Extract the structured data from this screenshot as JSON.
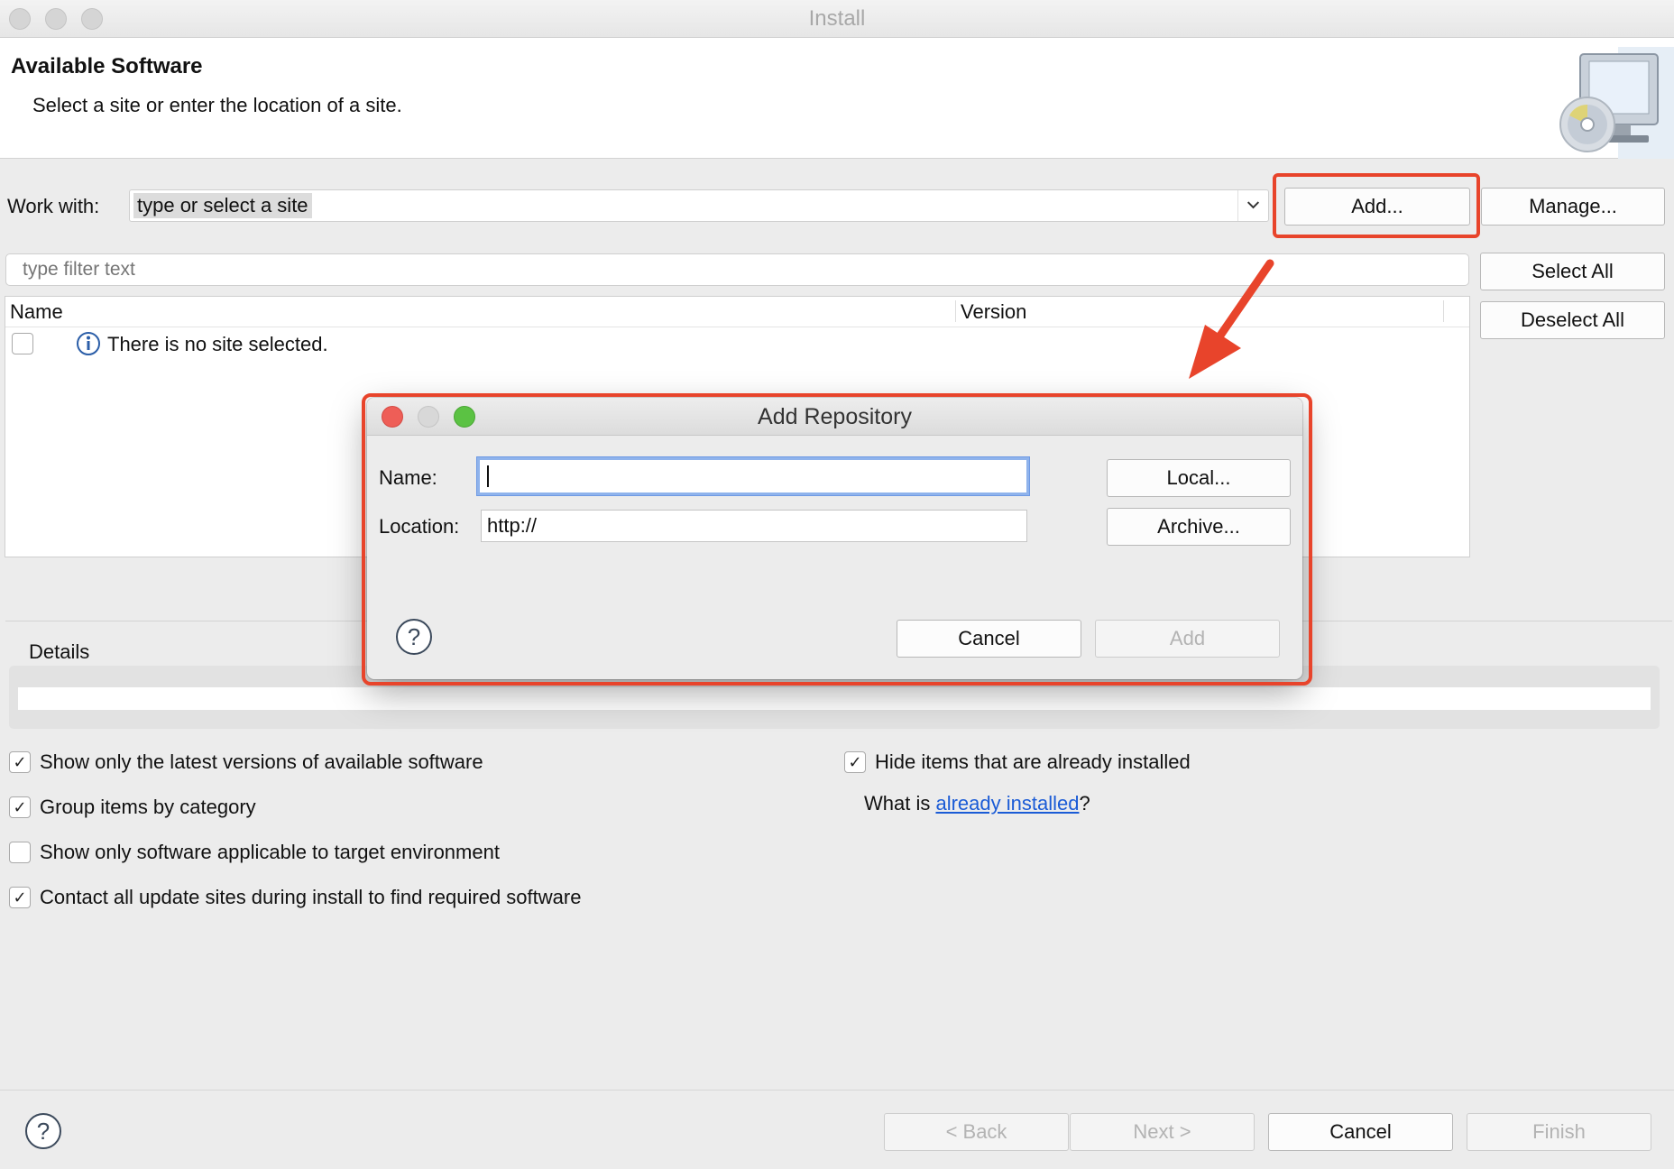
{
  "window": {
    "title": "Install"
  },
  "header": {
    "title": "Available Software",
    "subtitle": "Select a site or enter the location of a site."
  },
  "work_with": {
    "label": "Work with:",
    "value": "type or select a site",
    "add_label": "Add...",
    "manage_label": "Manage..."
  },
  "filter": {
    "placeholder": "type filter text"
  },
  "side_buttons": {
    "select_all": "Select All",
    "deselect_all": "Deselect All"
  },
  "table": {
    "columns": [
      "Name",
      "Version"
    ],
    "rows": [
      {
        "name": "There is no site selected.",
        "checked": false
      }
    ]
  },
  "details": {
    "label": "Details"
  },
  "options": [
    {
      "label": "Show only the latest versions of available software",
      "checked": true
    },
    {
      "label": "Group items by category",
      "checked": true
    },
    {
      "label": "Show only software applicable to target environment",
      "checked": false
    },
    {
      "label": "Contact all update sites during install to find required software",
      "checked": true
    },
    {
      "label": "Hide items that are already installed",
      "checked": true
    }
  ],
  "installed_hint": {
    "prefix": "What is ",
    "link": "already installed",
    "suffix": "?"
  },
  "footer": {
    "back": "< Back",
    "next": "Next >",
    "cancel": "Cancel",
    "finish": "Finish"
  },
  "dialog": {
    "title": "Add Repository",
    "name_label": "Name:",
    "name_value": "",
    "location_label": "Location:",
    "location_value": "http://",
    "local_label": "Local...",
    "archive_label": "Archive...",
    "cancel_label": "Cancel",
    "add_label": "Add"
  },
  "colors": {
    "annotation": "#e8442b",
    "link": "#1a5bd6",
    "focus": "#8fb3ec"
  }
}
